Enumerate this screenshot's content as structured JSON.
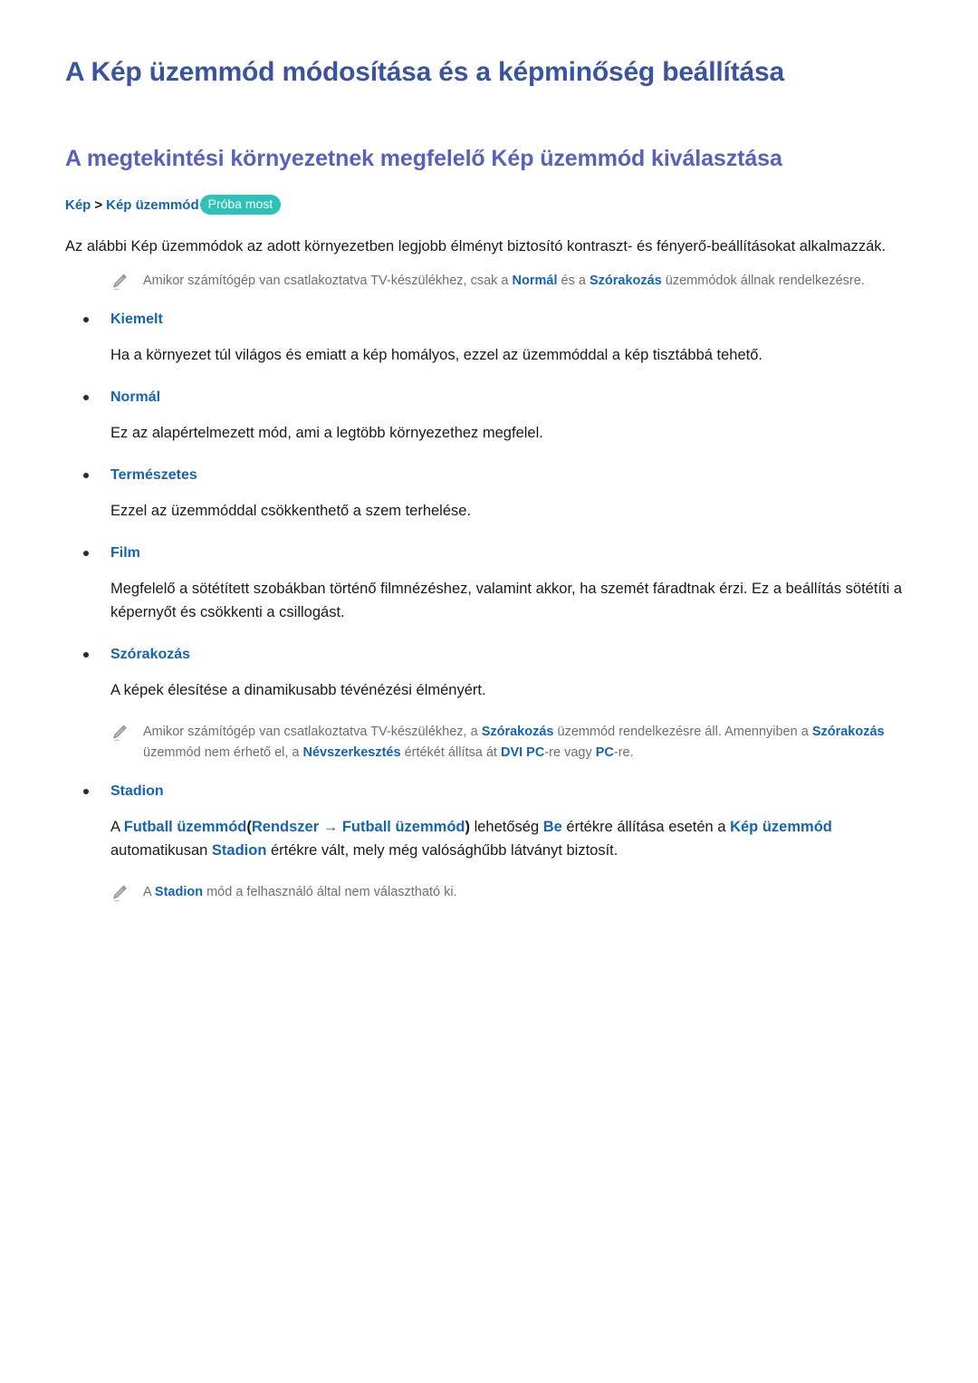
{
  "page": {
    "doc_title": "A Kép üzemmód módosítása és a képminőség beállítása",
    "section_title": "A megtekintési környezetnek megfelelő Kép üzemmód kiválasztása"
  },
  "breadcrumb": {
    "item1": "Kép",
    "separator": ">",
    "item2": "Kép üzemmód",
    "badge": "Próba most"
  },
  "intro": {
    "paragraph": "Az alábbi Kép üzemmódok az adott környezetben legjobb élményt biztosító kontraszt- és fényerő-beállításokat alkalmazzák."
  },
  "note1": {
    "icon": "pencil-icon",
    "part1": "Amikor számítógép van csatlakoztatva TV-készülékhez, csak a ",
    "bold1": "Normál",
    "part2": " és a ",
    "bold2": "Szórakozás",
    "part3": " üzemmódok állnak rendelkezésre."
  },
  "modes": [
    {
      "label": "Kiemelt",
      "description": "Ha a környezet túl világos és emiatt a kép homályos, ezzel az üzemmóddal a kép tisztábbá tehető."
    },
    {
      "label": "Normál",
      "description": "Ez az alapértelmezett mód, ami a legtöbb környezethez megfelel."
    },
    {
      "label": "Természetes",
      "description": "Ezzel az üzemmóddal csökkenthető a szem terhelése."
    },
    {
      "label": "Film",
      "description": "Megfelelő a sötétített szobákban történő filmnézéshez, valamint akkor, ha szemét fáradtnak érzi. Ez a beállítás sötétíti a képernyőt és csökkenti a csillogást."
    },
    {
      "label": "Szórakozás",
      "description": "A képek élesítése a dinamikusabb tévénézési élményért."
    },
    {
      "label": "Stadion",
      "description": ""
    }
  ],
  "note2": {
    "icon": "pencil-icon",
    "part1": "Amikor számítógép van csatlakoztatva TV-készülékhez, a ",
    "bold1": "Szórakozás",
    "part2": " üzemmód rendelkezésre áll. Amennyiben a ",
    "bold2": "Szórakozás",
    "part3": " üzemmód nem érhető el, a ",
    "bold3": "Névszerkesztés",
    "part4": " értékét állítsa át ",
    "bold4": "DVI PC",
    "part5": "-re vagy ",
    "bold5": "PC",
    "part6": "-re."
  },
  "stadion": {
    "part1": "A ",
    "bold1": "Futball üzemmód",
    "paren_open": "(",
    "bold2": "Rendszer",
    "arrow": " → ",
    "bold3": "Futball üzemmód",
    "paren_close": ")",
    "part2": " lehetőség ",
    "bold4": "Be",
    "part3": " értékre állítása esetén a ",
    "bold5": "Kép üzemmód",
    "part4": " automatikusan ",
    "bold6": "Stadion",
    "part5": " értékre vált, mely még valósághűbb látványt biztosít."
  },
  "note3": {
    "icon": "pencil-icon",
    "part1": "A ",
    "bold1": "Stadion",
    "part2": " mód a felhasználó által nem választható ki."
  },
  "colors": {
    "doc_title": "#3a54a0",
    "section_title": "#5b5fbe",
    "link_blue": "#1464b4",
    "badge_teal": "#2cc2b8",
    "note_gray": "#6f6f6f",
    "body_black": "#1a1a1a"
  }
}
